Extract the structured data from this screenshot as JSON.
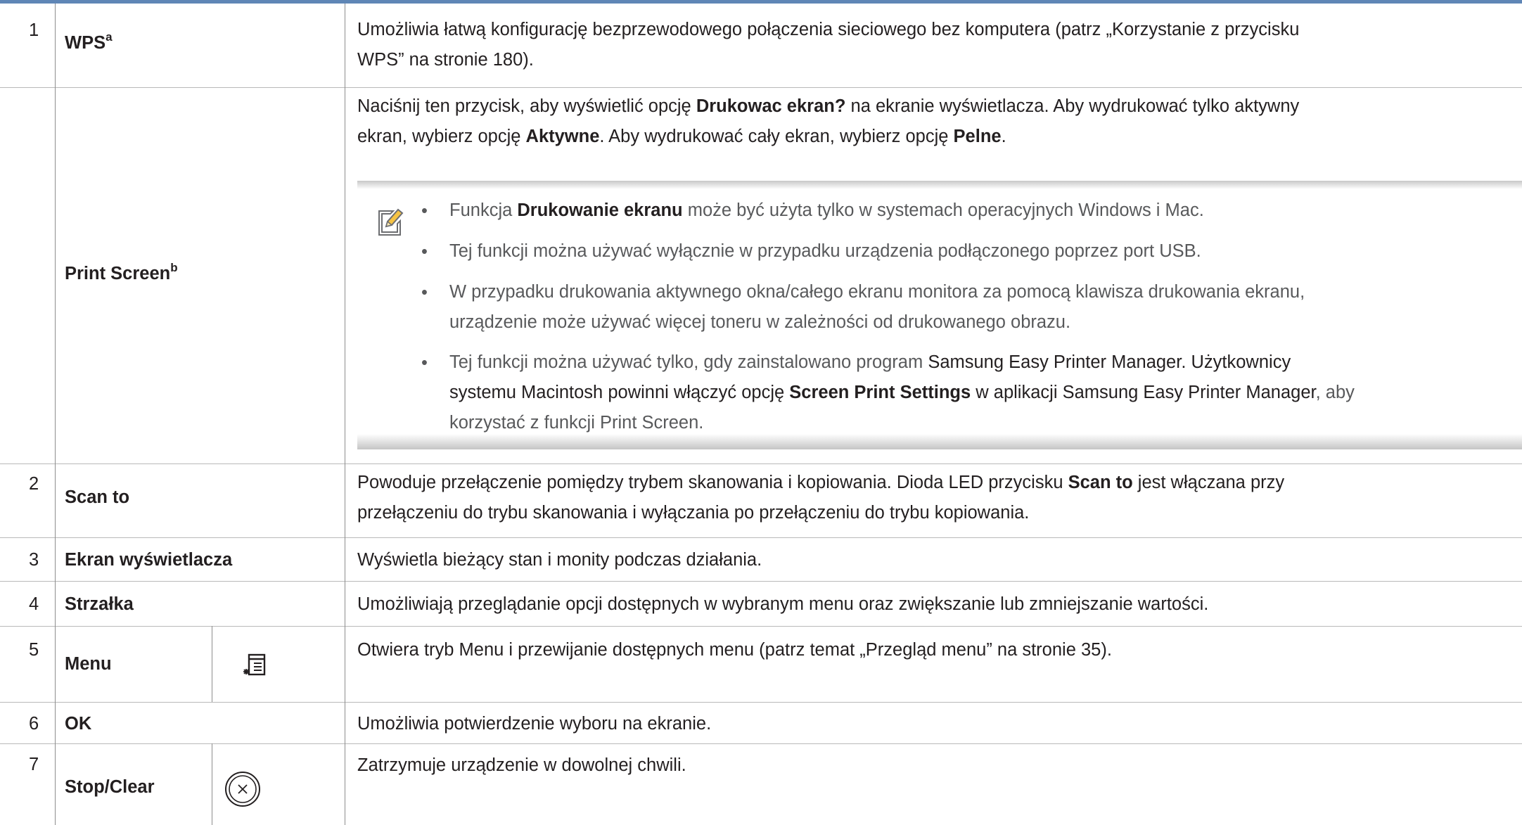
{
  "rows": [
    {
      "num": "1",
      "label": "WPS",
      "sup": "a",
      "desc": [
        "Umożliwia łatwą konfigurację bezprzewodowego połączenia sieciowego bez komputera (patrz „Korzystanie z przycisku",
        "WPS” na stronie 180)."
      ]
    },
    {
      "num": "",
      "label": "Print Screen",
      "sup": "b",
      "desc_l1": {
        "a": "Naciśnij ten przycisk, aby wyświetlić opcję ",
        "b": "Drukowac ekran?",
        "c": " na ekranie wyświetlacza. Aby wydrukować tylko aktywny"
      },
      "desc_l2": {
        "a": "ekran, wybierz opcję ",
        "b": "Aktywne",
        "c": ". Aby wydrukować cały ekran, wybierz opcję ",
        "d": "Pelne",
        "e": "."
      },
      "note": {
        "icon": "note-pencil-icon",
        "b1": {
          "a": "Funkcja ",
          "b": "Drukowanie ekranu",
          "c": " może być użyta tylko w systemach operacyjnych Windows i Mac."
        },
        "b2": "Tej funkcji można używać wyłącznie w przypadku urządzenia podłączonego poprzez port USB.",
        "b3": [
          "W przypadku drukowania aktywnego okna/całego ekranu monitora za pomocą klawisza drukowania ekranu,",
          "urządzenie może używać więcej toneru w zależności od drukowanego obrazu."
        ],
        "b4_l1": {
          "a": "Tej funkcji można używać tylko, gdy zainstalowano program ",
          "b": "Samsung Easy Printer Manager",
          "c": ". Użytkownicy"
        },
        "b4_l2": {
          "a": "systemu Macintosh powinni włączyć opcję ",
          "b": "Screen Print Settings",
          "c": " w aplikacji ",
          "d": "Samsung Easy Printer Manager",
          "e": ", aby"
        },
        "b4_l3": "korzystać z funkcji Print Screen."
      }
    },
    {
      "num": "2",
      "label": "Scan to",
      "desc_l1": {
        "a": "Powoduje przełączenie pomiędzy trybem skanowania i kopiowania. Dioda LED przycisku ",
        "b": "Scan to",
        "c": " jest włączana przy"
      },
      "desc_l2": "przełączeniu do trybu skanowania i wyłączania po przełączeniu do trybu kopiowania."
    },
    {
      "num": "3",
      "label": "Ekran wyświetlacza",
      "desc": "Wyświetla bieżący stan i monity podczas działania."
    },
    {
      "num": "4",
      "label": "Strzałka",
      "desc": "Umożliwiają przeglądanie opcji dostępnych w wybranym menu oraz zwiększanie lub zmniejszanie wartości."
    },
    {
      "num": "5",
      "label": "Menu",
      "icon": "menu-icon",
      "desc": "Otwiera tryb Menu i przewijanie dostępnych menu (patrz temat „Przegląd menu” na stronie 35)."
    },
    {
      "num": "6",
      "label": "OK",
      "desc": "Umożliwia potwierdzenie wyboru na ekranie."
    },
    {
      "num": "7",
      "label": "Stop/Clear",
      "icon": "stop-clear-icon",
      "desc": "Zatrzymuje urządzenie w dowolnej chwili."
    }
  ],
  "colors": {
    "rule": "#5f86b6",
    "text": "#231f20",
    "note_text": "#58595b",
    "grid": "#b9b9b9"
  }
}
